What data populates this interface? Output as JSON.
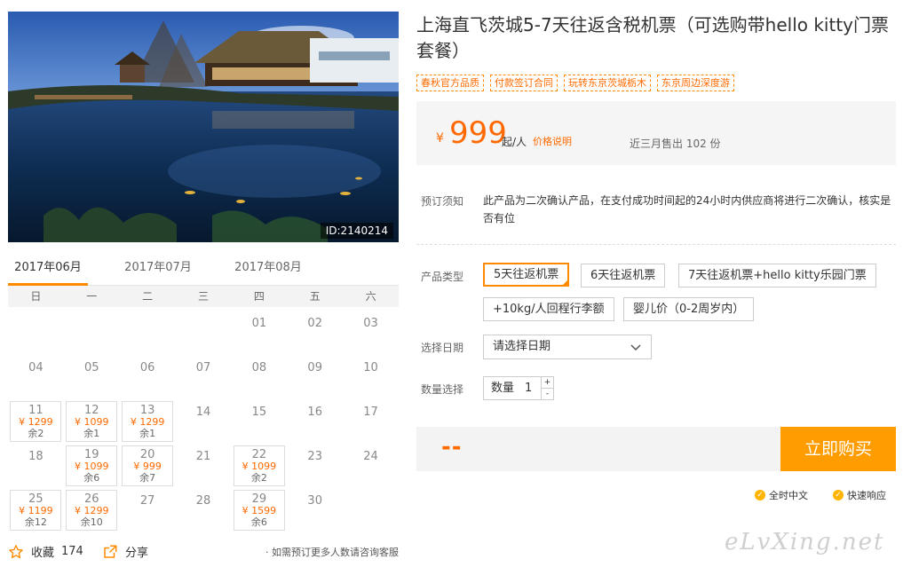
{
  "photo": {
    "id_label": "ID:2140214"
  },
  "months": [
    {
      "label": "2017年06月",
      "active": true
    },
    {
      "label": "2017年07月",
      "active": false
    },
    {
      "label": "2017年08月",
      "active": false
    }
  ],
  "weekdays": [
    "日",
    "一",
    "二",
    "三",
    "四",
    "五",
    "六"
  ],
  "calendar": [
    {
      "day": "01",
      "col": 4,
      "row": 0
    },
    {
      "day": "02",
      "col": 5,
      "row": 0
    },
    {
      "day": "03",
      "col": 6,
      "row": 0
    },
    {
      "day": "04",
      "col": 0,
      "row": 1
    },
    {
      "day": "05",
      "col": 1,
      "row": 1
    },
    {
      "day": "06",
      "col": 2,
      "row": 1
    },
    {
      "day": "07",
      "col": 3,
      "row": 1
    },
    {
      "day": "08",
      "col": 4,
      "row": 1
    },
    {
      "day": "09",
      "col": 5,
      "row": 1
    },
    {
      "day": "10",
      "col": 6,
      "row": 1
    },
    {
      "day": "11",
      "col": 0,
      "row": 2,
      "price": "¥ 1299",
      "rest": "余2"
    },
    {
      "day": "12",
      "col": 1,
      "row": 2,
      "price": "¥ 1099",
      "rest": "余1"
    },
    {
      "day": "13",
      "col": 2,
      "row": 2,
      "price": "¥ 1299",
      "rest": "余1"
    },
    {
      "day": "14",
      "col": 3,
      "row": 2
    },
    {
      "day": "15",
      "col": 4,
      "row": 2
    },
    {
      "day": "16",
      "col": 5,
      "row": 2
    },
    {
      "day": "17",
      "col": 6,
      "row": 2
    },
    {
      "day": "18",
      "col": 0,
      "row": 3
    },
    {
      "day": "19",
      "col": 1,
      "row": 3,
      "price": "¥ 1099",
      "rest": "余6"
    },
    {
      "day": "20",
      "col": 2,
      "row": 3,
      "price": "¥ 999",
      "rest": "余7"
    },
    {
      "day": "21",
      "col": 3,
      "row": 3
    },
    {
      "day": "22",
      "col": 4,
      "row": 3,
      "price": "¥ 1099",
      "rest": "余2"
    },
    {
      "day": "23",
      "col": 5,
      "row": 3
    },
    {
      "day": "24",
      "col": 6,
      "row": 3
    },
    {
      "day": "25",
      "col": 0,
      "row": 4,
      "price": "¥ 1199",
      "rest": "余12"
    },
    {
      "day": "26",
      "col": 1,
      "row": 4,
      "price": "¥ 1299",
      "rest": "余10"
    },
    {
      "day": "27",
      "col": 2,
      "row": 4
    },
    {
      "day": "28",
      "col": 3,
      "row": 4
    },
    {
      "day": "29",
      "col": 4,
      "row": 4,
      "price": "¥ 1599",
      "rest": "余6"
    },
    {
      "day": "30",
      "col": 5,
      "row": 4
    }
  ],
  "bottom": {
    "fav_label": "收藏",
    "fav_count": "174",
    "share_label": "分享",
    "contact_text": "· 如需预订更多人数请咨询客服"
  },
  "product": {
    "title": "上海直飞茨城5-7天往返含税机票（可选购带hello kitty门票套餐）",
    "tags": [
      "春秋官方品质",
      "付款签订合同",
      "玩转东京茨城栃木",
      "东京周边深度游"
    ]
  },
  "pricing": {
    "currency": "¥",
    "price": "999",
    "qi_label": "起/人",
    "explain_link": "价格说明",
    "sold_text": "近三月售出 102 份"
  },
  "notice": {
    "label": "预订须知",
    "text": "此产品为二次确认产品，在支付成功时间起的24小时内供应商将进行二次确认，核实是否有位"
  },
  "options": {
    "label": "产品类型",
    "items": [
      {
        "label": "5天往返机票",
        "selected": true
      },
      {
        "label": "6天往返机票",
        "selected": false
      },
      {
        "label": "7天往返机票+hello kitty乐园门票",
        "selected": false
      },
      {
        "label": "+10kg/人回程行李额",
        "selected": false
      },
      {
        "label": "婴儿价（0-2周岁内）",
        "selected": false
      }
    ]
  },
  "date": {
    "label": "选择日期",
    "placeholder": "请选择日期"
  },
  "quantity": {
    "label": "数量选择",
    "field_label": "数量",
    "value": "1",
    "plus": "+",
    "minus": "-"
  },
  "buy": {
    "total": "--",
    "button_label": "立即购买"
  },
  "services": [
    "全时中文",
    "快速响应"
  ],
  "watermark": "eLvXing.net",
  "colors": {
    "accent": "#ff8a00",
    "price": "#ff6a00",
    "button": "#ff9d00"
  }
}
